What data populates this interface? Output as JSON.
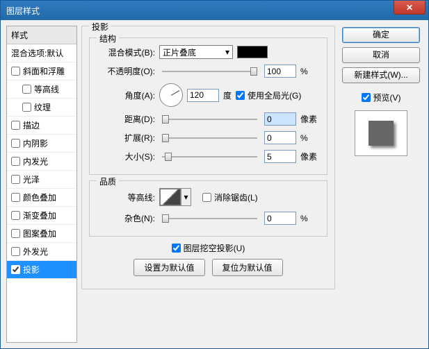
{
  "window": {
    "title": "图层样式"
  },
  "left": {
    "header": "样式",
    "blend_default": "混合选项:默认",
    "items": [
      {
        "key": "bevel",
        "label": "斜面和浮雕",
        "checked": false
      },
      {
        "key": "contour",
        "label": "等高线",
        "checked": false,
        "indent": true
      },
      {
        "key": "texture",
        "label": "纹理",
        "checked": false,
        "indent": true
      },
      {
        "key": "stroke",
        "label": "描边",
        "checked": false
      },
      {
        "key": "innershadow",
        "label": "内阴影",
        "checked": false
      },
      {
        "key": "innerglow",
        "label": "内发光",
        "checked": false
      },
      {
        "key": "satin",
        "label": "光泽",
        "checked": false
      },
      {
        "key": "coloroverlay",
        "label": "颜色叠加",
        "checked": false
      },
      {
        "key": "gradoverlay",
        "label": "渐变叠加",
        "checked": false
      },
      {
        "key": "patoverlay",
        "label": "图案叠加",
        "checked": false
      },
      {
        "key": "outerglow",
        "label": "外发光",
        "checked": false
      },
      {
        "key": "dropshadow",
        "label": "投影",
        "checked": true,
        "selected": true
      }
    ]
  },
  "main": {
    "legend": "投影",
    "structure": {
      "legend": "结构",
      "blend_label": "混合模式(B):",
      "blend_value": "正片叠底",
      "opacity_label": "不透明度(O):",
      "opacity_value": "100",
      "opacity_unit": "%",
      "angle_label": "角度(A):",
      "angle_value": "120",
      "angle_unit": "度",
      "global_light": "使用全局光(G)",
      "global_light_checked": true,
      "distance_label": "距离(D):",
      "distance_value": "0",
      "distance_unit": "像素",
      "spread_label": "扩展(R):",
      "spread_value": "0",
      "spread_unit": "%",
      "size_label": "大小(S):",
      "size_value": "5",
      "size_unit": "像素"
    },
    "quality": {
      "legend": "品质",
      "contour_label": "等高线:",
      "antialias": "消除锯齿(L)",
      "antialias_checked": false,
      "noise_label": "杂色(N):",
      "noise_value": "0",
      "noise_unit": "%"
    },
    "knockout": "图层挖空投影(U)",
    "knockout_checked": true,
    "set_default": "设置为默认值",
    "reset_default": "复位为默认值"
  },
  "right": {
    "ok": "确定",
    "cancel": "取消",
    "new_style": "新建样式(W)...",
    "preview_label": "预览(V)",
    "preview_checked": true
  }
}
